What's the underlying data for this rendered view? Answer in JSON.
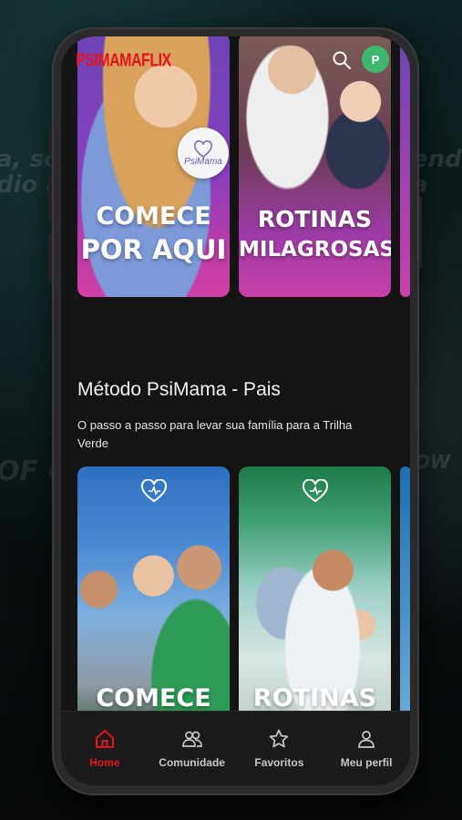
{
  "background": {
    "left_line1": "a, sobr",
    "left_line2": "dio do",
    "right_line1": "endo",
    "right_line2": "a",
    "left_line3": "OF CRI",
    "right_line3": "OW"
  },
  "header": {
    "logo": "PSIMAMAFLIX",
    "search_icon": "search-icon",
    "avatar_initial": "P",
    "avatar_color": "#3fb66c"
  },
  "top_row": [
    {
      "line1": "COMECE",
      "line2": "POR AQUI",
      "badge": "PsiMama"
    },
    {
      "line1": "ROTINAS",
      "line2": "MILAGROSAS"
    }
  ],
  "section": {
    "title": "Método PsiMama - Pais",
    "subtitle": "O passo a passo para levar sua família para a Trilha Verde"
  },
  "bottom_row": [
    {
      "title": "COMECE",
      "icon": "heart-icon"
    },
    {
      "title": "ROTINAS",
      "icon": "heart-icon"
    }
  ],
  "nav": {
    "items": [
      {
        "label": "Home",
        "icon": "home-icon",
        "active": true
      },
      {
        "label": "Comunidade",
        "icon": "community-icon",
        "active": false
      },
      {
        "label": "Favoritos",
        "icon": "star-icon",
        "active": false
      },
      {
        "label": "Meu perfil",
        "icon": "user-icon",
        "active": false
      }
    ]
  },
  "colors": {
    "accent": "#e3151c",
    "screen_bg": "#141414",
    "nav_bg": "#1b1b1c"
  }
}
